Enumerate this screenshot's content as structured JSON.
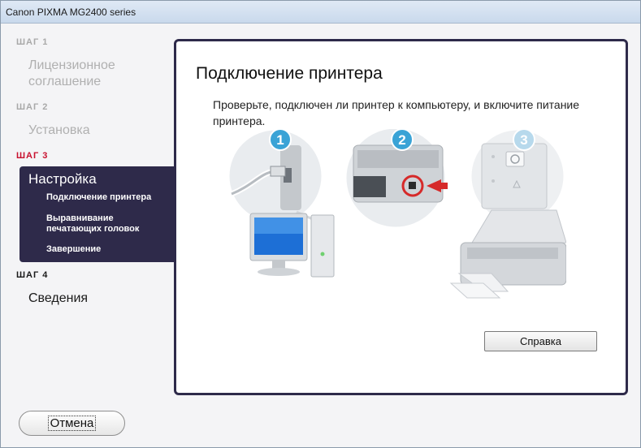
{
  "window": {
    "title": "Canon PIXMA MG2400 series"
  },
  "sidebar": {
    "step1": {
      "label": "ШАГ 1",
      "title_line1": "Лицензионное",
      "title_line2": "соглашение"
    },
    "step2": {
      "label": "ШАГ 2",
      "title": "Установка"
    },
    "step3": {
      "label": "ШАГ 3",
      "title": "Настройка",
      "subitems": [
        {
          "label_line1": "Подключение принтера",
          "label_line2": ""
        },
        {
          "label_line1": "Выравнивание",
          "label_line2": "печатающих головок"
        },
        {
          "label_line1": "Завершение",
          "label_line2": ""
        }
      ]
    },
    "step4": {
      "label": "ШАГ 4",
      "title": "Сведения"
    }
  },
  "main": {
    "heading": "Подключение принтера",
    "description": "Проверьте, подключен ли принтер к компьютеру, и включите питание принтера.",
    "illustration": {
      "badges": [
        "1",
        "2",
        "3"
      ]
    },
    "help_button": "Справка"
  },
  "footer": {
    "cancel_button": "Отмена"
  },
  "colors": {
    "accent_dark": "#2e2a4a",
    "step_active_red": "#c8102e",
    "badge_blue": "#3aa3d6"
  }
}
